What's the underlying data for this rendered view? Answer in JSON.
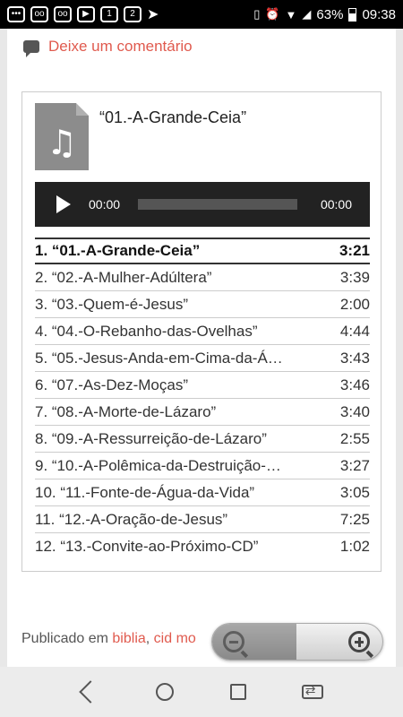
{
  "status_bar": {
    "battery_percent": "63%",
    "time": "09:38",
    "icons": [
      "messages-icon",
      "voicemail-icon",
      "voicemail-icon",
      "youtube-icon",
      "sim1-icon",
      "sim2-icon",
      "telegram-icon",
      "vibrate-icon",
      "alarm-icon",
      "wifi-icon",
      "signal-icon"
    ]
  },
  "comment_link": {
    "label": "Deixe um comentário"
  },
  "playlist": {
    "current_title": "“01.-A-Grande-Ceia”",
    "player": {
      "current_time": "00:00",
      "duration": "00:00"
    },
    "tracks": [
      {
        "name": "1. “01.-A-Grande-Ceia”",
        "duration": "3:21"
      },
      {
        "name": "2. “02.-A-Mulher-Adúltera”",
        "duration": "3:39"
      },
      {
        "name": "3. “03.-Quem-é-Jesus”",
        "duration": "2:00"
      },
      {
        "name": "4. “04.-O-Rebanho-das-Ovelhas”",
        "duration": "4:44"
      },
      {
        "name": "5. “05.-Jesus-Anda-em-Cima-da-Á…",
        "duration": "3:43"
      },
      {
        "name": "6. “07.-As-Dez-Moças”",
        "duration": "3:46"
      },
      {
        "name": "7. “08.-A-Morte-de-Lázaro”",
        "duration": "3:40"
      },
      {
        "name": "8. “09.-A-Ressurreição-de-Lázaro”",
        "duration": "2:55"
      },
      {
        "name": "9. “10.-A-Polêmica-da-Destruição-…",
        "duration": "3:27"
      },
      {
        "name": "10. “11.-Fonte-de-Água-da-Vida”",
        "duration": "3:05"
      },
      {
        "name": "11. “12.-A-Oração-de-Jesus”",
        "duration": "7:25"
      },
      {
        "name": "12. “13.-Convite-ao-Próximo-CD”",
        "duration": "1:02"
      }
    ]
  },
  "footer": {
    "published_prefix": "Publicado em",
    "category_1": "biblia",
    "separator": ",",
    "category_2": "cid mo"
  },
  "colors": {
    "accent": "#e05a4e",
    "player_bg": "#222222"
  }
}
